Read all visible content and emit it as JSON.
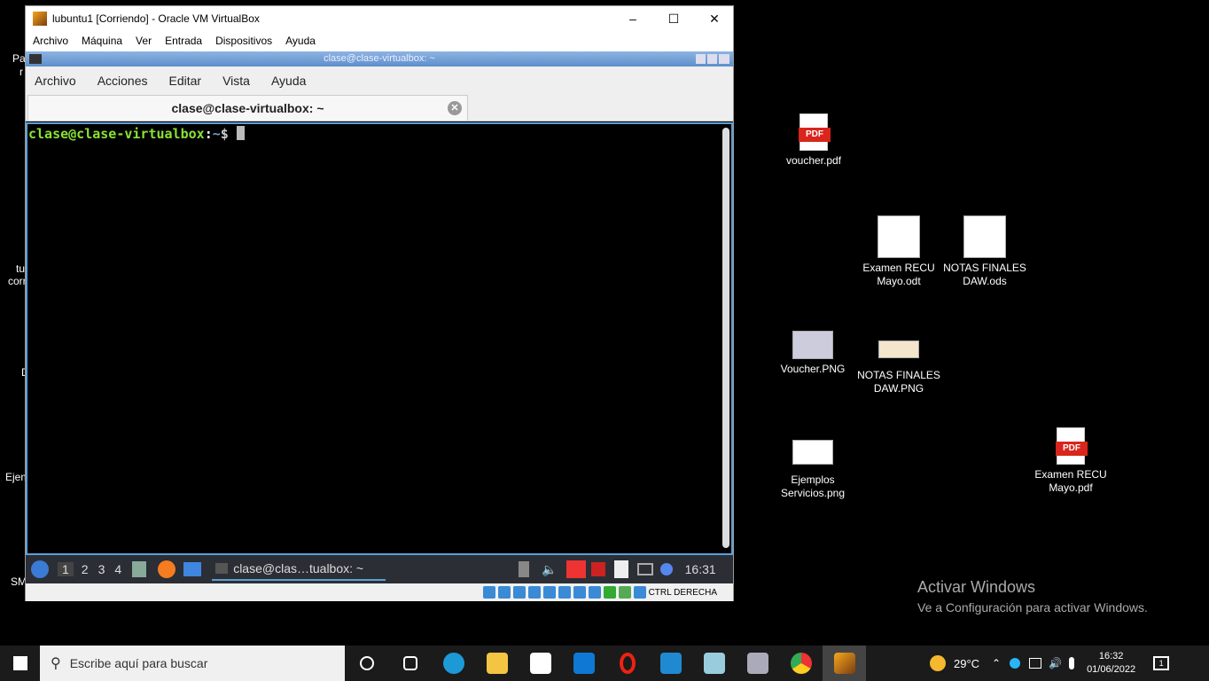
{
  "edge_fragments": [
    "Pa",
    "r",
    "tu",
    "corr",
    "D",
    "Ejem",
    "SM"
  ],
  "vbox": {
    "title": "lubuntu1 [Corriendo] - Oracle VM VirtualBox",
    "menu": [
      "Archivo",
      "Máquina",
      "Ver",
      "Entrada",
      "Dispositivos",
      "Ayuda"
    ],
    "status_key": "CTRL DERECHA"
  },
  "terminal": {
    "window_title": "clase@clase-virtualbox: ~",
    "menu": [
      "Archivo",
      "Acciones",
      "Editar",
      "Vista",
      "Ayuda"
    ],
    "tab_label": "clase@clase-virtualbox: ~",
    "prompt_user": "clase@clase-virtualbox",
    "prompt_sep": ":",
    "prompt_path": "~",
    "prompt_symbol": "$"
  },
  "lxpanel": {
    "workspaces": [
      "1",
      "2",
      "3",
      "4"
    ],
    "task_label": "clase@clas…tualbox: ~",
    "clock": "16:31"
  },
  "desktop_icons": [
    {
      "label": "voucher.pdf",
      "type": "pdf",
      "badge": "PDF"
    },
    {
      "label": "Examen RECU Mayo.odt",
      "type": "doc"
    },
    {
      "label": "NOTAS FINALES DAW.ods",
      "type": "doc"
    },
    {
      "label": "Voucher.PNG",
      "type": "img"
    },
    {
      "label": "NOTAS FINALES DAW.PNG",
      "type": "img"
    },
    {
      "label": "Ejemplos Servicios.png",
      "type": "img"
    },
    {
      "label": "Examen RECU Mayo.pdf",
      "type": "pdf",
      "badge": "PDF"
    }
  ],
  "activation": {
    "title": "Activar Windows",
    "subtitle": "Ve a Configuración para activar Windows."
  },
  "taskbar": {
    "search_placeholder": "Escribe aquí para buscar",
    "weather": "29°C",
    "time": "16:32",
    "date": "01/06/2022",
    "notifications": "1"
  },
  "colors": {
    "prompt_green": "#8ae234",
    "prompt_blue": "#729fcf",
    "terminal_border": "#5d9fd6"
  }
}
